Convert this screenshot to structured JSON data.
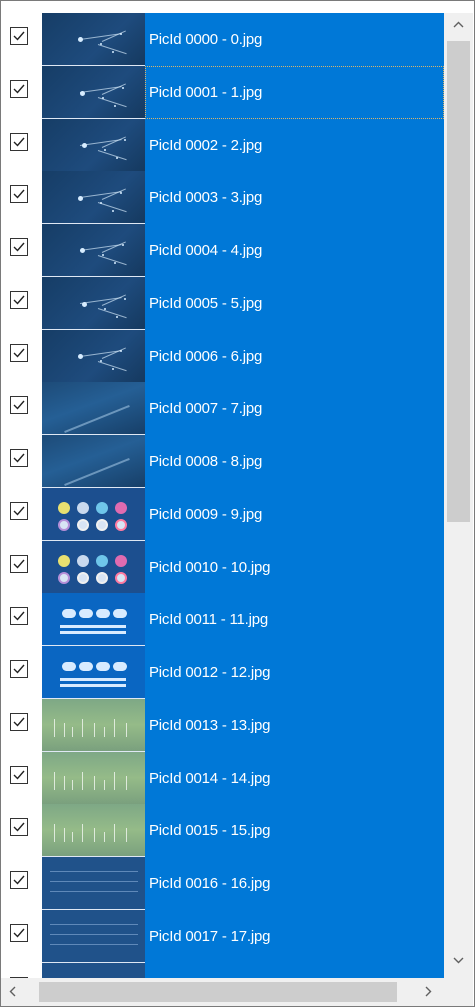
{
  "list": {
    "items": [
      {
        "label": "PicId 0000 - 0.jpg",
        "checked": true,
        "thumb": "dark-constellation"
      },
      {
        "label": "PicId 0001 - 1.jpg",
        "checked": true,
        "thumb": "dark-constellation"
      },
      {
        "label": "PicId 0002 - 2.jpg",
        "checked": true,
        "thumb": "dark-constellation"
      },
      {
        "label": "PicId 0003 - 3.jpg",
        "checked": true,
        "thumb": "dark-constellation"
      },
      {
        "label": "PicId 0004 - 4.jpg",
        "checked": true,
        "thumb": "dark-constellation"
      },
      {
        "label": "PicId 0005 - 5.jpg",
        "checked": true,
        "thumb": "dark-constellation"
      },
      {
        "label": "PicId 0006 - 6.jpg",
        "checked": true,
        "thumb": "dark-constellation"
      },
      {
        "label": "PicId 0007 - 7.jpg",
        "checked": true,
        "thumb": "dark-smoke"
      },
      {
        "label": "PicId 0008 - 8.jpg",
        "checked": true,
        "thumb": "dark-smoke"
      },
      {
        "label": "PicId 0009 - 9.jpg",
        "checked": true,
        "thumb": "circle-icons"
      },
      {
        "label": "PicId 0010 - 10.jpg",
        "checked": true,
        "thumb": "circle-icons"
      },
      {
        "label": "PicId 0011 - 11.jpg",
        "checked": true,
        "thumb": "blue-panel"
      },
      {
        "label": "PicId 0012 - 12.jpg",
        "checked": true,
        "thumb": "blue-panel"
      },
      {
        "label": "PicId 0013 - 13.jpg",
        "checked": true,
        "thumb": "green-chart"
      },
      {
        "label": "PicId 0014 - 14.jpg",
        "checked": true,
        "thumb": "green-chart"
      },
      {
        "label": "PicId 0015 - 15.jpg",
        "checked": true,
        "thumb": "green-chart"
      },
      {
        "label": "PicId 0016 - 16.jpg",
        "checked": true,
        "thumb": "blue-map"
      },
      {
        "label": "PicId 0017 - 17.jpg",
        "checked": true,
        "thumb": "blue-map"
      }
    ],
    "selection_color": "#0078d7",
    "focused_index": 1
  },
  "scrollbars": {
    "vertical": {
      "up_icon": "chevron-up-icon",
      "down_icon": "chevron-down-icon"
    },
    "horizontal": {
      "left_icon": "chevron-left-icon",
      "right_icon": "chevron-right-icon"
    }
  }
}
